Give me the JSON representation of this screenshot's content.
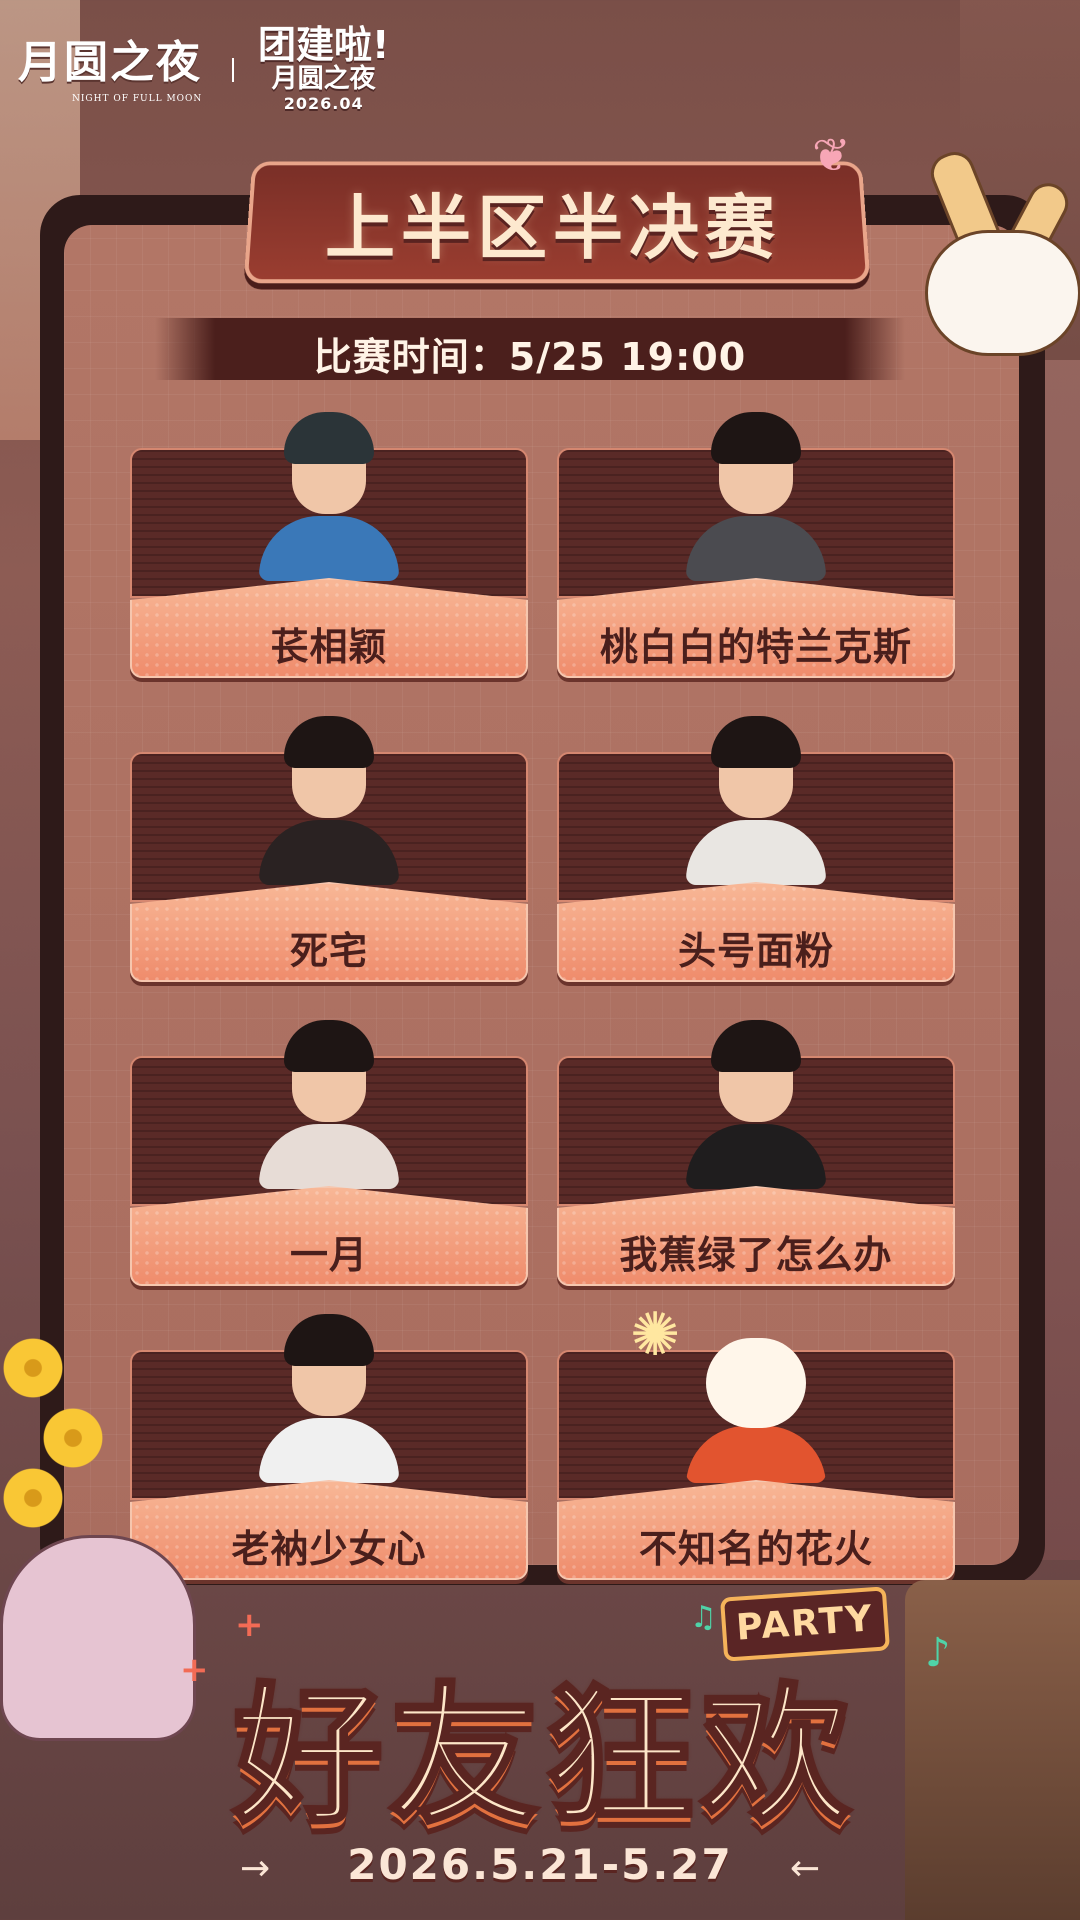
{
  "header": {
    "game_logo": "月圆之夜",
    "game_logo_sub": "NIGHT OF FULL MOON",
    "event_logo_line1": "团建啦!",
    "event_logo_line2": "月圆之夜",
    "event_logo_date": "2026.04"
  },
  "title": "上半区半决赛",
  "match_time": "比赛时间：5/25 19:00",
  "players": [
    {
      "name": "苌相颖",
      "avatar": "game-character"
    },
    {
      "name": "桃白白的特兰克斯",
      "avatar": "person"
    },
    {
      "name": "死宅",
      "avatar": "person"
    },
    {
      "name": "头号面粉",
      "avatar": "person"
    },
    {
      "name": "一月",
      "avatar": "person"
    },
    {
      "name": "我蕉绿了怎么办",
      "avatar": "person"
    },
    {
      "name": "老衲少女心",
      "avatar": "person"
    },
    {
      "name": "不知名的花火",
      "avatar": "mascot"
    }
  ],
  "footer": {
    "party_tag": "PARTY",
    "banner_title": "好友狂欢",
    "date_range": "2026.5.21-5.27"
  },
  "colors": {
    "board": "#2e1a19",
    "card_top": "#5a2a27",
    "card_bottom": "#ef8c6c",
    "name_text": "#4a1f1c",
    "accent": "#e2713f"
  }
}
